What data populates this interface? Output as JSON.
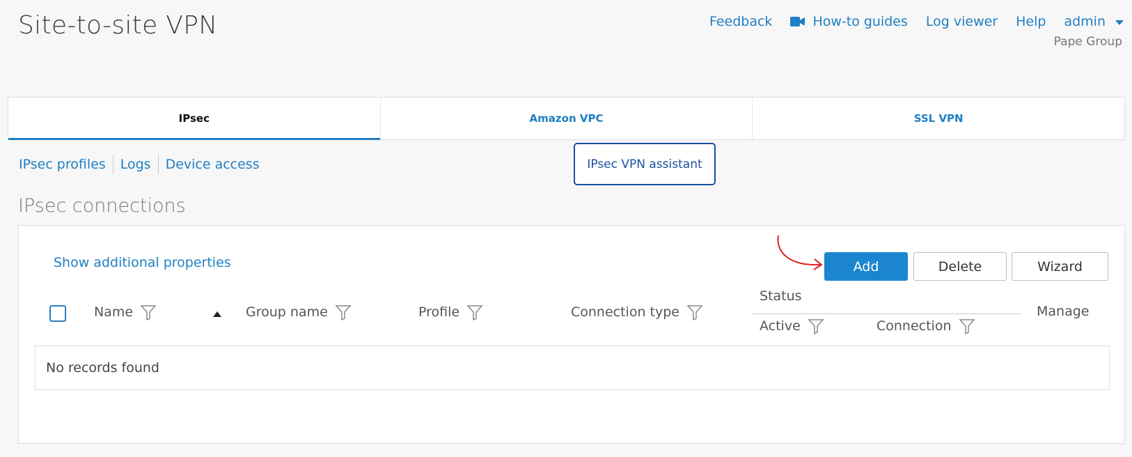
{
  "page": {
    "title": "Site-to-site VPN"
  },
  "top_nav": {
    "feedback": "Feedback",
    "howto": "How-to guides",
    "logviewer": "Log viewer",
    "help": "Help",
    "user": "admin",
    "org": "Pape Group"
  },
  "tabs": [
    {
      "label": "IPsec",
      "active": true
    },
    {
      "label": "Amazon VPC",
      "active": false
    },
    {
      "label": "SSL VPN",
      "active": false
    }
  ],
  "sub_links": [
    "IPsec profiles",
    "Logs",
    "Device access"
  ],
  "assistant_button": "IPsec VPN assistant",
  "section_title": "IPsec connections",
  "panel": {
    "show_props": "Show additional properties",
    "buttons": {
      "add": "Add",
      "delete": "Delete",
      "wizard": "Wizard"
    },
    "columns": {
      "name": "Name",
      "group_name": "Group name",
      "profile": "Profile",
      "connection_type": "Connection type",
      "status": "Status",
      "active": "Active",
      "connection": "Connection",
      "manage": "Manage"
    },
    "empty_message": "No records found"
  },
  "colors": {
    "accent": "#1f7fc4",
    "primary_button": "#1b85d0",
    "annotation": "#e02020"
  }
}
